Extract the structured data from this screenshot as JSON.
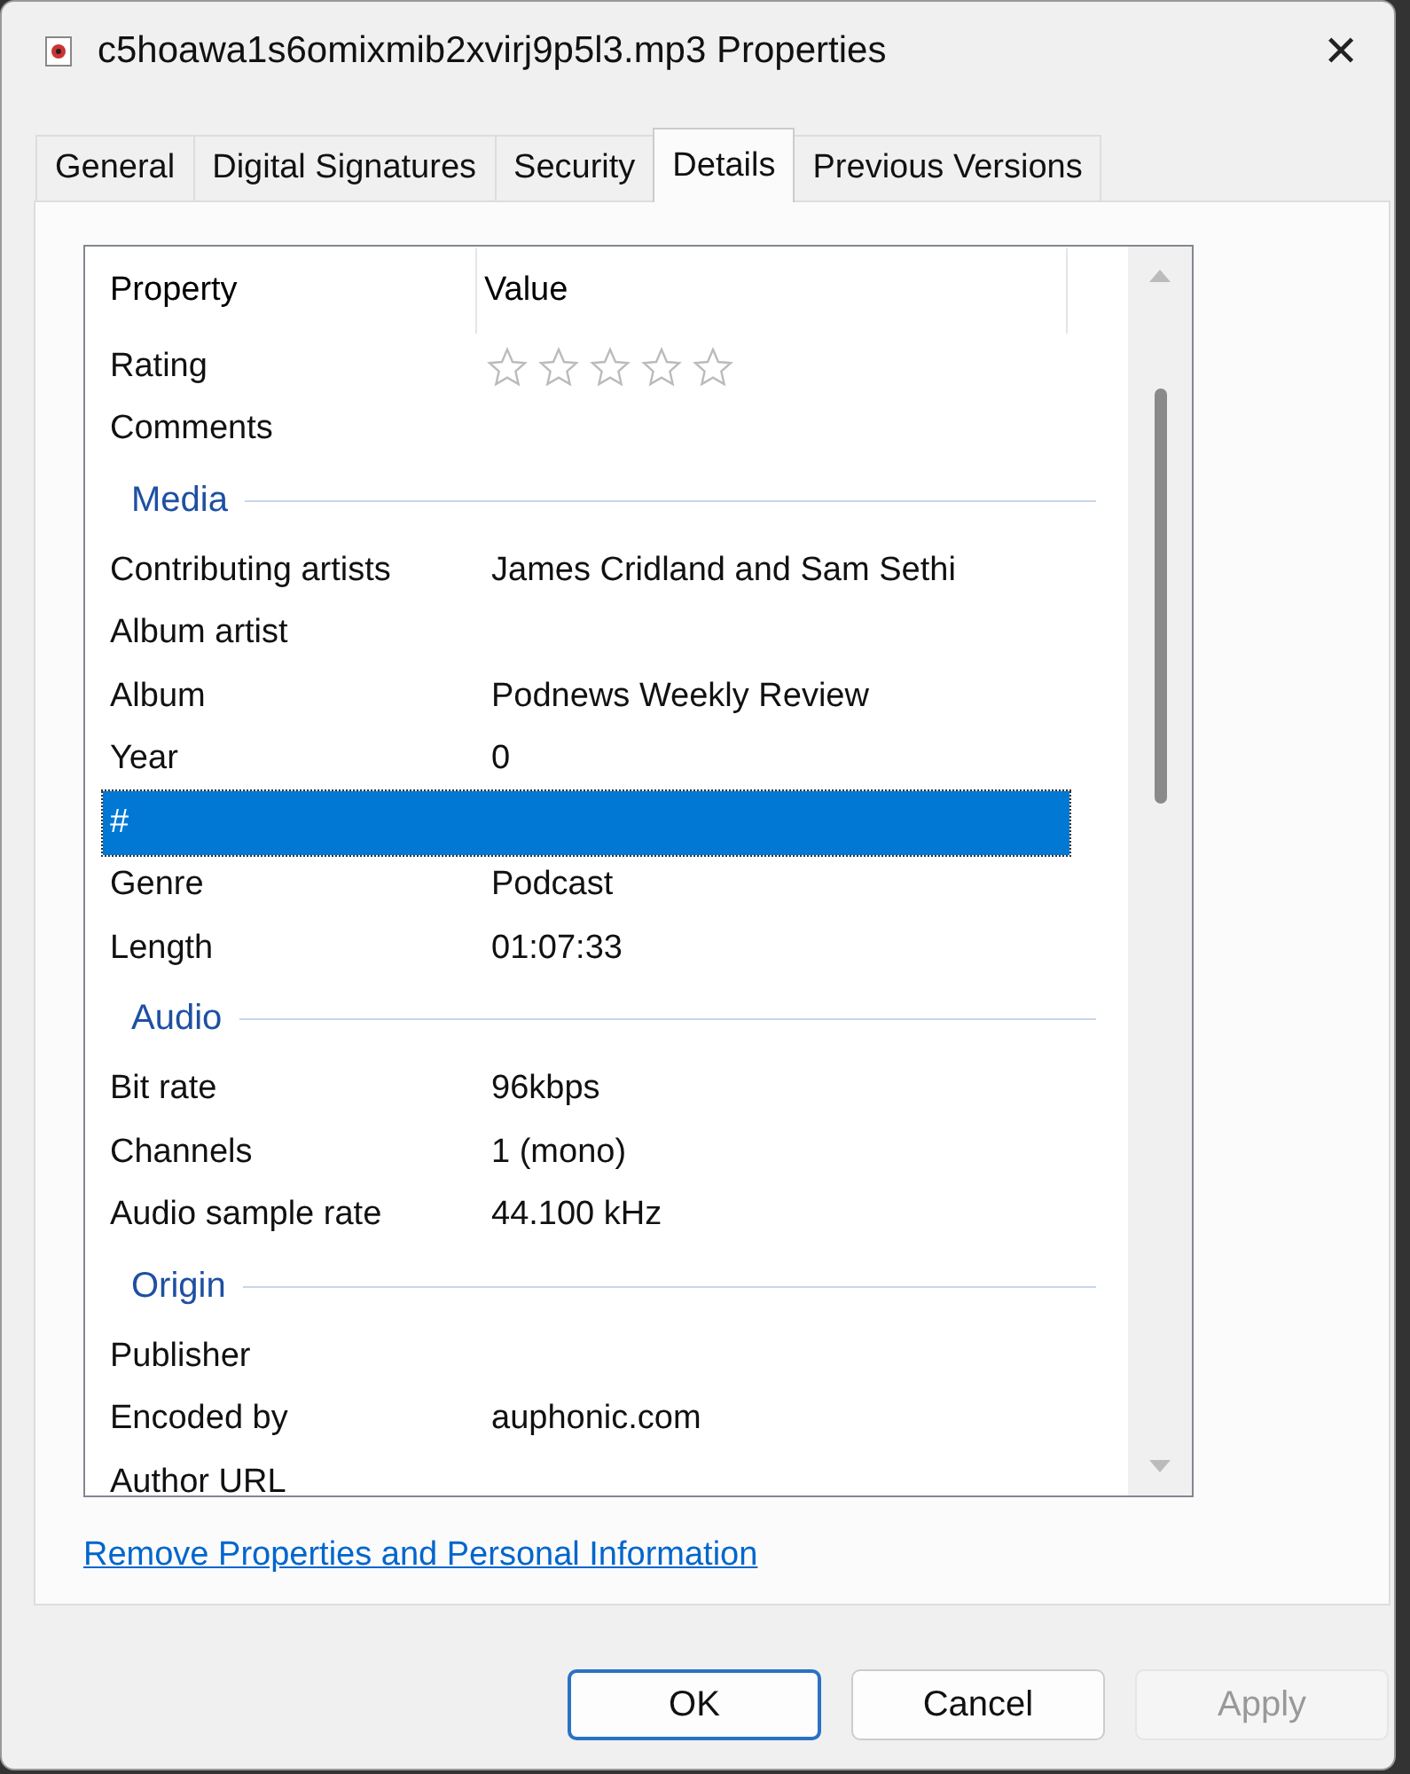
{
  "window": {
    "title": "c5hoawa1s6omixmib2xvirj9p5l3.mp3 Properties",
    "close": "✕"
  },
  "tabs": [
    {
      "label": "General",
      "selected": false
    },
    {
      "label": "Digital Signatures",
      "selected": false
    },
    {
      "label": "Security",
      "selected": false
    },
    {
      "label": "Details",
      "selected": true
    },
    {
      "label": "Previous Versions",
      "selected": false
    }
  ],
  "table": {
    "columns": [
      "Property",
      "Value"
    ],
    "rows": [
      {
        "kind": "stars",
        "property": "Rating",
        "stars": 0,
        "selected": false
      },
      {
        "kind": "row",
        "property": "Comments",
        "value": "",
        "selected": false
      },
      {
        "kind": "group",
        "label": "Media"
      },
      {
        "kind": "row",
        "property": "Contributing artists",
        "value": "James Cridland and Sam Sethi",
        "selected": false
      },
      {
        "kind": "row",
        "property": "Album artist",
        "value": "",
        "selected": false
      },
      {
        "kind": "row",
        "property": "Album",
        "value": "Podnews Weekly Review",
        "selected": false
      },
      {
        "kind": "row",
        "property": "Year",
        "value": "0",
        "selected": false
      },
      {
        "kind": "row",
        "property": "#",
        "value": "",
        "selected": true
      },
      {
        "kind": "row",
        "property": "Genre",
        "value": "Podcast",
        "selected": false
      },
      {
        "kind": "row",
        "property": "Length",
        "value": "01:07:33",
        "selected": false
      },
      {
        "kind": "group",
        "label": "Audio"
      },
      {
        "kind": "row",
        "property": "Bit rate",
        "value": "96kbps",
        "selected": false
      },
      {
        "kind": "row",
        "property": "Channels",
        "value": "1 (mono)",
        "selected": false
      },
      {
        "kind": "row",
        "property": "Audio sample rate",
        "value": "44.100 kHz",
        "selected": false
      },
      {
        "kind": "group",
        "label": "Origin"
      },
      {
        "kind": "row",
        "property": "Publisher",
        "value": "",
        "selected": false
      },
      {
        "kind": "row",
        "property": "Encoded by",
        "value": "auphonic.com",
        "selected": false
      },
      {
        "kind": "row",
        "property": "Author URL",
        "value": "",
        "selected": false
      }
    ]
  },
  "link": "Remove Properties and Personal Information",
  "buttons": [
    {
      "label": "OK",
      "disabled": false,
      "default": true
    },
    {
      "label": "Cancel",
      "disabled": false,
      "default": false
    },
    {
      "label": "Apply",
      "disabled": true,
      "default": false
    }
  ]
}
